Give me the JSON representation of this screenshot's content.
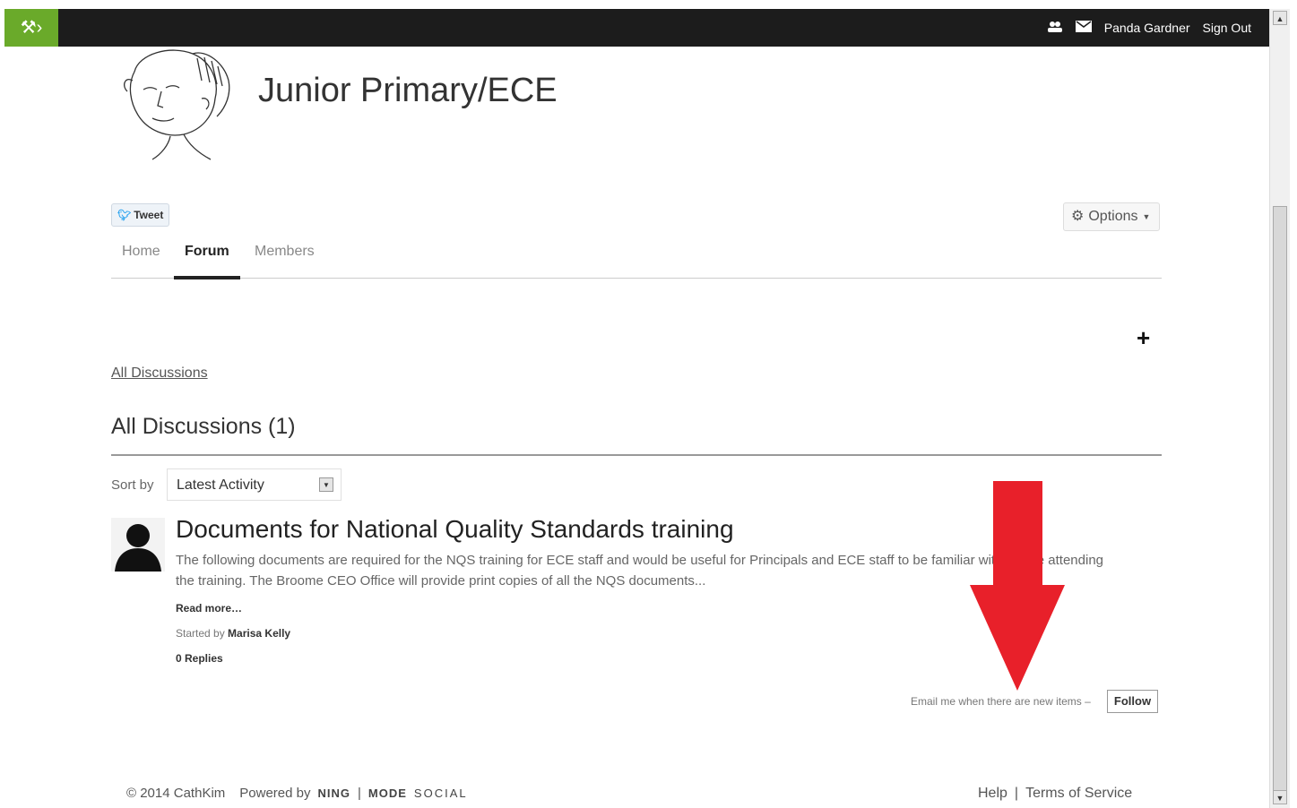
{
  "topbar": {
    "ning_icon": "tools-icon",
    "user_name": "Panda Gardner",
    "sign_out": "Sign Out"
  },
  "group": {
    "title": "Junior Primary/ECE"
  },
  "share": {
    "tweet_label": "Tweet"
  },
  "options": {
    "label": "Options"
  },
  "tabs": [
    {
      "label": "Home"
    },
    {
      "label": "Forum"
    },
    {
      "label": "Members"
    }
  ],
  "forum": {
    "add_icon": "+",
    "all_link": "All Discussions",
    "section_title": "All Discussions (1)",
    "sort_label": "Sort by",
    "sort_value": "Latest Activity"
  },
  "discussion": {
    "title": "Documents for National Quality Standards training",
    "excerpt": "The following documents are required for the NQS training for ECE staff and would be useful for Principals and ECE staff to be familiar with before attending the training. The Broome CEO Office will provide print copies of all the NQS documents...",
    "read_more": "Read more…",
    "started_prefix": "Started by",
    "author": "Marisa Kelly",
    "replies": "0 Replies"
  },
  "follow": {
    "note": "Email me when there are new items –",
    "button": "Follow"
  },
  "footer": {
    "copyright": "© 2014 CathKim",
    "powered_by": "Powered by",
    "brand_ning": "NING",
    "brand_sep": "|",
    "brand_mode": "MODE",
    "brand_social": "SOCIAL",
    "help": "Help",
    "sep": "|",
    "terms": "Terms of Service"
  },
  "colors": {
    "topbar": "#1c1c1c",
    "ning_green": "#6aaa2a",
    "annotation_arrow": "#e8202a"
  }
}
